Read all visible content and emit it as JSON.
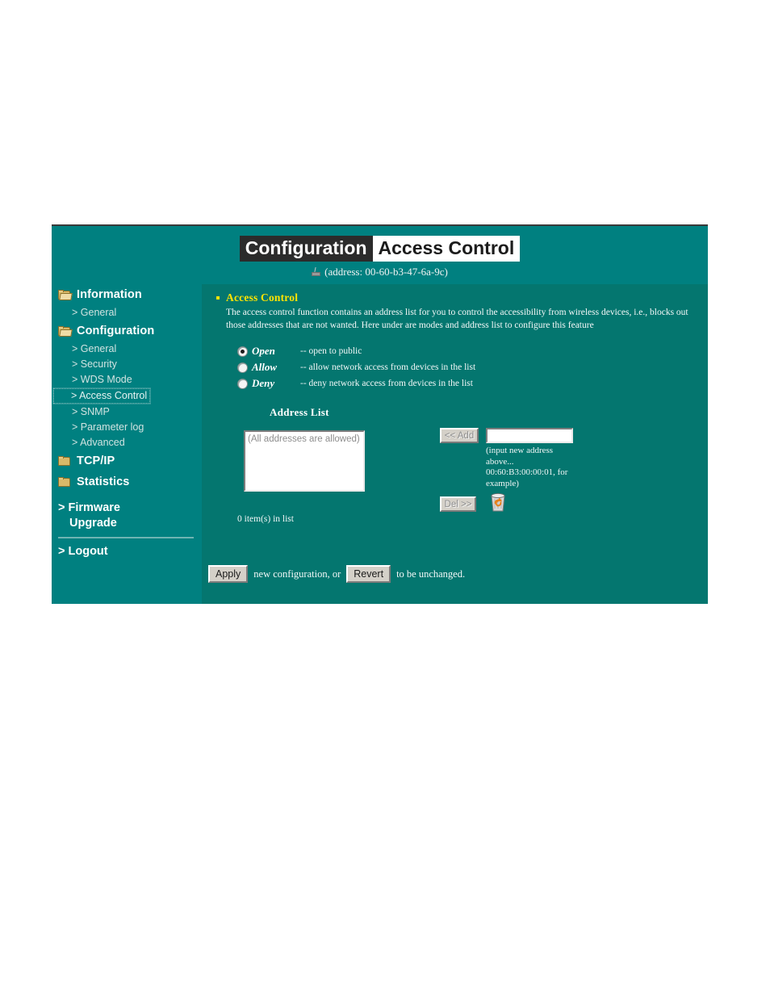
{
  "header": {
    "title_left": "Configuration",
    "title_right": "Access Control",
    "address_label": "(address: 00-60-b3-47-6a-9c)"
  },
  "sidebar": {
    "groups": [
      {
        "label": "Information",
        "icon": "open-folder-icon",
        "items": [
          {
            "label": "> General",
            "selected": false
          }
        ]
      },
      {
        "label": "Configuration",
        "icon": "open-folder-icon",
        "items": [
          {
            "label": "> General",
            "selected": false
          },
          {
            "label": "> Security",
            "selected": false
          },
          {
            "label": "> WDS Mode",
            "selected": false
          },
          {
            "label": "> Access Control",
            "selected": true
          },
          {
            "label": "> SNMP",
            "selected": false
          },
          {
            "label": "> Parameter log",
            "selected": false
          },
          {
            "label": "> Advanced",
            "selected": false
          }
        ]
      },
      {
        "label": "TCP/IP",
        "icon": "closed-folder-icon",
        "items": []
      },
      {
        "label": "Statistics",
        "icon": "closed-folder-icon",
        "items": []
      }
    ],
    "firmware_upgrade_line1": "> Firmware",
    "firmware_upgrade_line2": "Upgrade",
    "logout": "> Logout"
  },
  "main": {
    "section_title": "Access Control",
    "section_desc": "The access control function contains an address list for you to control the accessibility from wireless devices, i.e., blocks out those addresses that are not wanted. Here under are modes and address list to configure this feature",
    "modes": [
      {
        "name": "Open",
        "desc": "-- open to public",
        "checked": true
      },
      {
        "name": "Allow",
        "desc": "-- allow network access from devices in the list",
        "checked": false
      },
      {
        "name": "Deny",
        "desc": "-- deny network access from devices in the list",
        "checked": false
      }
    ],
    "address_list_title": "Address List",
    "listbox_placeholder": "(All addresses are allowed)",
    "add_button": "<< Add",
    "del_button": "Del >>",
    "address_input_value": "",
    "address_hint": "(input new address above... 00:60:B3:00:00:01, for example)",
    "item_count": "0 item(s) in list",
    "apply_button": "Apply",
    "apply_suffix": "new configuration, or",
    "revert_button": "Revert",
    "revert_suffix": "to be unchanged."
  },
  "colors": {
    "panel_teal": "#008080",
    "content_teal": "#04766f",
    "accent_yellow": "#ffe400",
    "title_dark": "#2b2b2b"
  }
}
